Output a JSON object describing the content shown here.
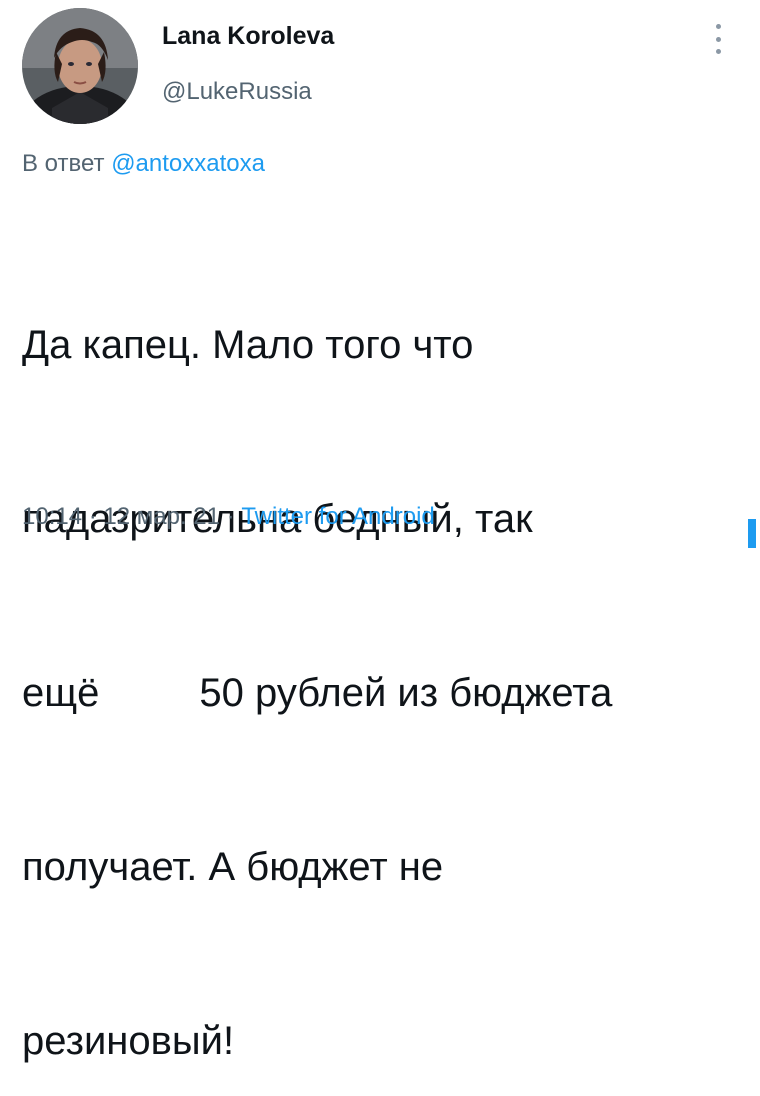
{
  "author": {
    "name": "Lana Koroleva",
    "handle": "@LukeRussia"
  },
  "reply": {
    "prefix": "В ответ",
    "mention": "@antoxxatoxa"
  },
  "tweet": {
    "lines": [
      "Да капец. Мало того что",
      "падазрительна бедный, так",
      "ещё         50 рублей из бюджета",
      "получает. А бюджет не",
      "резиновый!"
    ]
  },
  "meta": {
    "time": "10:14",
    "separator": "·",
    "date": "12 мар. 21",
    "source": "Twitter for Android"
  },
  "icons": {
    "more": "more-vertical-icon"
  },
  "colors": {
    "accent": "#1d9bf0",
    "secondary_text": "#536471",
    "primary_text": "#0f1419"
  }
}
